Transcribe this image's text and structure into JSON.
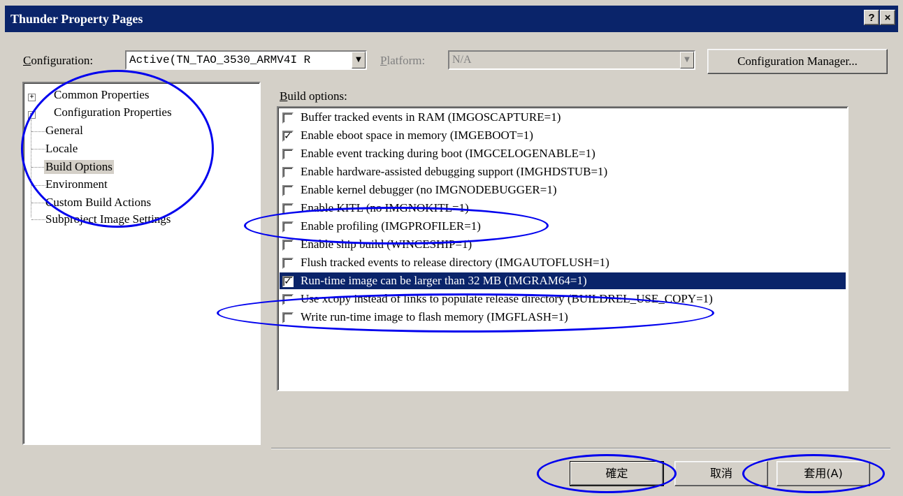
{
  "window": {
    "title": "Thunder Property Pages",
    "help_button": "?",
    "close_button": "×"
  },
  "config_bar": {
    "configuration_label": "Configuration:",
    "configuration_value": "Active(TN_TAO_3530_ARMV4I R",
    "platform_label": "Platform:",
    "platform_value": "N/A",
    "config_manager_button": "Configuration Manager..."
  },
  "tree": {
    "items": [
      {
        "label": "Common Properties",
        "expander": "+"
      },
      {
        "label": "Configuration Properties",
        "expander": "−"
      },
      {
        "label": "General"
      },
      {
        "label": "Locale"
      },
      {
        "label": "Build Options",
        "selected": true
      },
      {
        "label": "Environment"
      },
      {
        "label": "Custom Build Actions"
      },
      {
        "label": "Subproject Image Settings"
      }
    ]
  },
  "build_options": {
    "label": "Build options:",
    "items": [
      {
        "label": "Buffer tracked events in RAM (IMGOSCAPTURE=1)",
        "checked": false
      },
      {
        "label": "Enable eboot space in memory (IMGEBOOT=1)",
        "checked": true
      },
      {
        "label": "Enable event tracking during boot (IMGCELOGENABLE=1)",
        "checked": false
      },
      {
        "label": "Enable hardware-assisted debugging support (IMGHDSTUB=1)",
        "checked": false
      },
      {
        "label": "Enable kernel debugger (no IMGNODEBUGGER=1)",
        "checked": false
      },
      {
        "label": "Enable KITL (no IMGNOKITL=1)",
        "checked": false
      },
      {
        "label": "Enable profiling (IMGPROFILER=1)",
        "checked": false
      },
      {
        "label": "Enable ship build (WINCESHIP=1)",
        "checked": false
      },
      {
        "label": "Flush tracked events to release directory (IMGAUTOFLUSH=1)",
        "checked": false
      },
      {
        "label": "Run-time image can be larger than 32 MB (IMGRAM64=1)",
        "checked": true,
        "selected": true
      },
      {
        "label": "Use xcopy instead of links to populate release directory (BUILDREL_USE_COPY=1)",
        "checked": false
      },
      {
        "label": "Write run-time image to flash memory (IMGFLASH=1)",
        "checked": false
      }
    ]
  },
  "buttons": {
    "ok": "確定",
    "cancel": "取消",
    "apply": "套用(A)"
  },
  "colors": {
    "annotation": "#0000ee",
    "titlebar": "#0a246a",
    "selection": "#0a246a"
  }
}
